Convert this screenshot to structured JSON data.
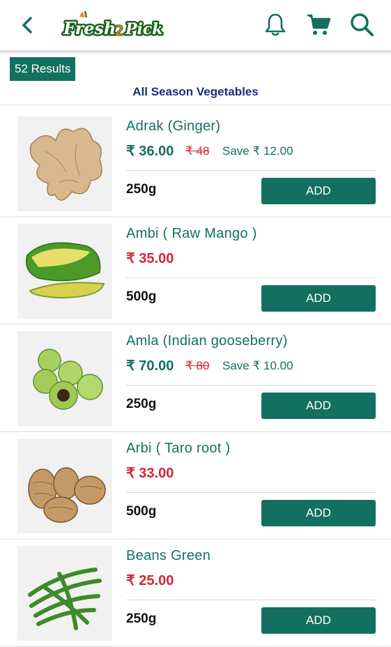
{
  "header": {
    "logo_text": "Fresh 2 Pick"
  },
  "results_label": "52 Results",
  "category_title": "All Season Vegetables",
  "products": [
    {
      "name": "Adrak (Ginger)",
      "price": "₹ 36.00",
      "mrp": "₹ 48",
      "save": "Save ₹ 12.00",
      "weight": "250g",
      "add_label": "ADD",
      "image": "ginger"
    },
    {
      "name": "Ambi ( Raw Mango )",
      "price": "₹ 35.00",
      "mrp": "",
      "save": "",
      "weight": "500g",
      "add_label": "ADD",
      "image": "mango"
    },
    {
      "name": "Amla (Indian gooseberry)",
      "price": "₹ 70.00",
      "mrp": "₹ 80",
      "save": "Save ₹ 10.00",
      "weight": "250g",
      "add_label": "ADD",
      "image": "amla"
    },
    {
      "name": "Arbi ( Taro root )",
      "price": "₹ 33.00",
      "mrp": "",
      "save": "",
      "weight": "500g",
      "add_label": "ADD",
      "image": "taro"
    },
    {
      "name": "Beans Green",
      "price": "₹ 25.00",
      "mrp": "",
      "save": "",
      "weight": "250g",
      "add_label": "ADD",
      "image": "beans"
    }
  ],
  "colors": {
    "brand": "#137060",
    "discount_red": "#d62631",
    "category_blue": "#1b2f7a"
  }
}
